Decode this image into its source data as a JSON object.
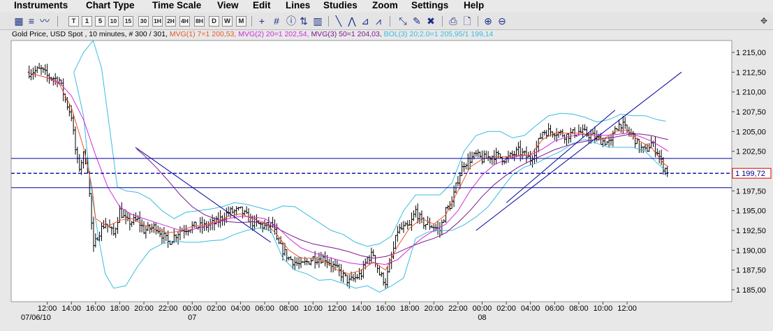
{
  "menu": [
    "Instruments",
    "Chart Type",
    "Time Scale",
    "View",
    "Edit",
    "Lines",
    "Studies",
    "Zoom",
    "Settings",
    "Help"
  ],
  "toolbar": {
    "timescale_buttons": [
      "T",
      "1",
      "5",
      "10",
      "15",
      "30",
      "1H",
      "2H",
      "4H",
      "8H",
      "D",
      "W",
      "M"
    ]
  },
  "legend": {
    "instrument": "Gold Price, USD Spot , 10 minutes, # 300 / 301,",
    "mvg1": "MVG(1) 7=1 200,53,",
    "mvg2": "MVG(2) 20=1 202,54,",
    "mvg3": "MVG(3) 50=1 204,03,",
    "bol": "BOL(3) 20;2.0=1 205,95/1 199,14"
  },
  "colors": {
    "price": "#000000",
    "mvg1": "#e8562a",
    "mvg2": "#d02adc",
    "mvg3": "#7a1a8c",
    "bol": "#38bde0",
    "lines": "#0000a0",
    "last_box": "#e00000"
  },
  "chart_data": {
    "type": "ohlc",
    "ylim": [
      1183.5,
      1216.5
    ],
    "y_ticks": [
      "1 185,00",
      "1 187,50",
      "1 190,00",
      "1 192,50",
      "1 195,00",
      "1 197,50",
      "1 200,00",
      "1 202,50",
      "1 205,00",
      "1 207,50",
      "1 210,00",
      "1 212,50",
      "1 215,00"
    ],
    "y_tick_values": [
      1185,
      1187.5,
      1190,
      1192.5,
      1195,
      1197.5,
      1200,
      1202.5,
      1205,
      1207.5,
      1210,
      1212.5,
      1215
    ],
    "x_ticks": [
      "12:00",
      "14:00",
      "16:00",
      "18:00",
      "20:00",
      "22:00",
      "00:00",
      "02:00",
      "04:00",
      "06:00",
      "08:00",
      "10:00",
      "12:00",
      "14:00",
      "16:00",
      "18:00",
      "20:00",
      "22:00",
      "00:00",
      "02:00",
      "04:00",
      "06:00",
      "08:00",
      "10:00",
      "12:00"
    ],
    "x_dates": [
      "07/06/10",
      "07",
      "08"
    ],
    "last_price_label": "1 199,72",
    "last_price": 1199.72,
    "horizontal_lines": [
      1201.6,
      1199.72,
      1197.9
    ],
    "price_path": [
      [
        10.5,
        1212.5
      ],
      [
        11.5,
        1212.8
      ],
      [
        12,
        1212
      ],
      [
        13,
        1211.5
      ],
      [
        13.5,
        1209
      ],
      [
        14,
        1207
      ],
      [
        14.3,
        1203
      ],
      [
        14.6,
        1200.2
      ],
      [
        15,
        1202
      ],
      [
        15.3,
        1201
      ],
      [
        15.6,
        1195
      ],
      [
        15.8,
        1190
      ],
      [
        16.2,
        1192
      ],
      [
        16.8,
        1193.5
      ],
      [
        17.5,
        1192
      ],
      [
        18,
        1195
      ],
      [
        18.6,
        1193.5
      ],
      [
        19.5,
        1193.8
      ],
      [
        20,
        1192.5
      ],
      [
        21,
        1193
      ],
      [
        22,
        1191
      ],
      [
        23,
        1192.5
      ],
      [
        24,
        1193
      ],
      [
        25,
        1193
      ],
      [
        26,
        1193.5
      ],
      [
        27,
        1194.8
      ],
      [
        28,
        1195
      ],
      [
        29,
        1193.5
      ],
      [
        30,
        1193
      ],
      [
        30.7,
        1193.2
      ],
      [
        31,
        1191
      ],
      [
        32,
        1189
      ],
      [
        33,
        1188
      ],
      [
        34,
        1189
      ],
      [
        35,
        1189
      ],
      [
        36,
        1187.5
      ],
      [
        37,
        1186
      ],
      [
        38,
        1187
      ],
      [
        38.5,
        1189
      ],
      [
        39,
        1189.5
      ],
      [
        39.5,
        1187
      ],
      [
        40,
        1186
      ],
      [
        40.5,
        1189
      ],
      [
        41,
        1192.5
      ],
      [
        42,
        1193
      ],
      [
        42.5,
        1195
      ],
      [
        43,
        1193.5
      ],
      [
        44,
        1193
      ],
      [
        44.5,
        1192.5
      ],
      [
        45,
        1195
      ],
      [
        45.5,
        1196
      ],
      [
        46,
        1199
      ],
      [
        46.5,
        1201
      ],
      [
        47.5,
        1202
      ],
      [
        48,
        1201.5
      ],
      [
        49,
        1202
      ],
      [
        50,
        1201.5
      ],
      [
        51,
        1202.5
      ],
      [
        52,
        1201.5
      ],
      [
        52.5,
        1203
      ],
      [
        53,
        1205
      ],
      [
        54,
        1205
      ],
      [
        55,
        1204.5
      ],
      [
        56,
        1205
      ],
      [
        57,
        1204.5
      ],
      [
        58,
        1203.8
      ],
      [
        58.7,
        1203.5
      ],
      [
        59,
        1205.5
      ],
      [
        59.5,
        1206
      ],
      [
        60,
        1205
      ],
      [
        60.5,
        1204.5
      ],
      [
        61,
        1203
      ],
      [
        61.5,
        1202.5
      ],
      [
        62,
        1203.5
      ],
      [
        62.5,
        1202.5
      ],
      [
        63,
        1200.5
      ],
      [
        63.4,
        1200
      ]
    ],
    "mvg1": [
      [
        10.5,
        1212.4
      ],
      [
        12,
        1211.8
      ],
      [
        13,
        1211
      ],
      [
        14,
        1208
      ],
      [
        15,
        1203
      ],
      [
        15.7,
        1198
      ],
      [
        16,
        1194
      ],
      [
        17,
        1193
      ],
      [
        18,
        1193.8
      ],
      [
        19,
        1194
      ],
      [
        20,
        1193.2
      ],
      [
        21,
        1192.6
      ],
      [
        22,
        1192.2
      ],
      [
        23,
        1192.4
      ],
      [
        24,
        1193
      ],
      [
        25,
        1193.2
      ],
      [
        26,
        1193.6
      ],
      [
        27,
        1194.3
      ],
      [
        28,
        1194.6
      ],
      [
        29,
        1194
      ],
      [
        30,
        1193.5
      ],
      [
        31,
        1192
      ],
      [
        32,
        1190
      ],
      [
        33,
        1189
      ],
      [
        34,
        1189
      ],
      [
        35,
        1188.5
      ],
      [
        36,
        1187.5
      ],
      [
        37,
        1187
      ],
      [
        38,
        1187.5
      ],
      [
        39,
        1188.5
      ],
      [
        40,
        1187.5
      ],
      [
        41,
        1190.5
      ],
      [
        42,
        1192.8
      ],
      [
        43,
        1194
      ],
      [
        44,
        1193.3
      ],
      [
        45,
        1194.5
      ],
      [
        46,
        1197.5
      ],
      [
        47,
        1200.5
      ],
      [
        48,
        1201.5
      ],
      [
        49,
        1201.8
      ],
      [
        50,
        1201.8
      ],
      [
        51,
        1202
      ],
      [
        52,
        1202
      ],
      [
        53,
        1204
      ],
      [
        54,
        1204.8
      ],
      [
        55,
        1204.8
      ],
      [
        56,
        1204.8
      ],
      [
        57,
        1204.6
      ],
      [
        58,
        1204
      ],
      [
        59,
        1205
      ],
      [
        60,
        1205.2
      ],
      [
        61,
        1203.8
      ],
      [
        62,
        1203
      ],
      [
        63,
        1201
      ],
      [
        63.4,
        1200.5
      ]
    ],
    "mvg2": [
      [
        10.5,
        1212.4
      ],
      [
        12,
        1211.8
      ],
      [
        13,
        1211.2
      ],
      [
        14,
        1209.5
      ],
      [
        15,
        1206.5
      ],
      [
        16,
        1202
      ],
      [
        17,
        1198
      ],
      [
        18,
        1195.5
      ],
      [
        19,
        1194.5
      ],
      [
        20,
        1194
      ],
      [
        21,
        1193.5
      ],
      [
        22,
        1193
      ],
      [
        23,
        1192.5
      ],
      [
        24,
        1192.6
      ],
      [
        25,
        1193
      ],
      [
        26,
        1193.5
      ],
      [
        27,
        1194
      ],
      [
        28,
        1194.3
      ],
      [
        29,
        1194.2
      ],
      [
        30,
        1194
      ],
      [
        31,
        1193
      ],
      [
        32,
        1191.5
      ],
      [
        33,
        1190.3
      ],
      [
        34,
        1189.7
      ],
      [
        35,
        1189.2
      ],
      [
        36,
        1188.8
      ],
      [
        37,
        1188.4
      ],
      [
        38,
        1188.2
      ],
      [
        39,
        1188.4
      ],
      [
        40,
        1188.2
      ],
      [
        41,
        1188.8
      ],
      [
        42,
        1190.2
      ],
      [
        43,
        1191.5
      ],
      [
        44,
        1192.5
      ],
      [
        45,
        1193.3
      ],
      [
        46,
        1195
      ],
      [
        47,
        1197.5
      ],
      [
        48,
        1199.5
      ],
      [
        49,
        1200.8
      ],
      [
        50,
        1201.5
      ],
      [
        51,
        1201.9
      ],
      [
        52,
        1202
      ],
      [
        53,
        1202.8
      ],
      [
        54,
        1203.8
      ],
      [
        55,
        1204.3
      ],
      [
        56,
        1204.6
      ],
      [
        57,
        1204.7
      ],
      [
        58,
        1204.5
      ],
      [
        59,
        1204.6
      ],
      [
        60,
        1204.8
      ],
      [
        61,
        1204.4
      ],
      [
        62,
        1203.8
      ],
      [
        63,
        1202.9
      ],
      [
        63.4,
        1202.5
      ]
    ],
    "mvg3": [
      [
        19.4,
        1202.8
      ],
      [
        20,
        1202
      ],
      [
        21,
        1200.5
      ],
      [
        22,
        1198.8
      ],
      [
        23,
        1197
      ],
      [
        24,
        1195.5
      ],
      [
        25,
        1194.5
      ],
      [
        26,
        1193.9
      ],
      [
        27,
        1193.6
      ],
      [
        28,
        1193.5
      ],
      [
        29,
        1193.6
      ],
      [
        30,
        1193.4
      ],
      [
        31,
        1192.8
      ],
      [
        32,
        1192
      ],
      [
        33,
        1191.3
      ],
      [
        34,
        1190.8
      ],
      [
        35,
        1190.5
      ],
      [
        36,
        1190.2
      ],
      [
        37,
        1189.8
      ],
      [
        38,
        1189.3
      ],
      [
        39,
        1189
      ],
      [
        40,
        1189.2
      ],
      [
        41,
        1189.7
      ],
      [
        42,
        1190.4
      ],
      [
        43,
        1191
      ],
      [
        44,
        1191.5
      ],
      [
        45,
        1192.2
      ],
      [
        46,
        1193.5
      ],
      [
        47,
        1195
      ],
      [
        48,
        1196.8
      ],
      [
        49,
        1198.3
      ],
      [
        50,
        1199.5
      ],
      [
        51,
        1200.5
      ],
      [
        52,
        1201.3
      ],
      [
        53,
        1202
      ],
      [
        54,
        1202.7
      ],
      [
        55,
        1203.2
      ],
      [
        56,
        1203.6
      ],
      [
        57,
        1203.9
      ],
      [
        58,
        1204.1
      ],
      [
        59,
        1204.3
      ],
      [
        60,
        1204.6
      ],
      [
        61,
        1204.7
      ],
      [
        62,
        1204.5
      ],
      [
        63,
        1204.1
      ],
      [
        63.4,
        1204
      ]
    ],
    "bol_upper": [
      [
        14.2,
        1212.5
      ],
      [
        15,
        1215
      ],
      [
        15.8,
        1216.5
      ],
      [
        16.5,
        1213
      ],
      [
        17.2,
        1205
      ],
      [
        17.8,
        1198
      ],
      [
        18.5,
        1197.5
      ],
      [
        19.5,
        1197.3
      ],
      [
        20.5,
        1196.5
      ],
      [
        21.5,
        1195
      ],
      [
        22.5,
        1194
      ],
      [
        23.5,
        1194.8
      ],
      [
        24.5,
        1195
      ],
      [
        25.5,
        1195.2
      ],
      [
        26.5,
        1195.5
      ],
      [
        27.5,
        1196
      ],
      [
        28.5,
        1195.8
      ],
      [
        29.5,
        1195.4
      ],
      [
        30.5,
        1195
      ],
      [
        31.5,
        1195.6
      ],
      [
        32.5,
        1195.5
      ],
      [
        33.5,
        1194.5
      ],
      [
        34.5,
        1193.5
      ],
      [
        35.5,
        1192.5
      ],
      [
        36.5,
        1192
      ],
      [
        37.5,
        1191
      ],
      [
        38.5,
        1190.5
      ],
      [
        39.5,
        1190.8
      ],
      [
        40.5,
        1191.8
      ],
      [
        41.5,
        1195
      ],
      [
        42.5,
        1197
      ],
      [
        43.5,
        1197
      ],
      [
        44.5,
        1197
      ],
      [
        45.5,
        1198.5
      ],
      [
        46.5,
        1202.5
      ],
      [
        47.5,
        1204.5
      ],
      [
        48.5,
        1205
      ],
      [
        49.5,
        1205
      ],
      [
        50.5,
        1204.2
      ],
      [
        51.5,
        1204.5
      ],
      [
        52.5,
        1205.8
      ],
      [
        53.5,
        1207
      ],
      [
        54.5,
        1207.3
      ],
      [
        55.5,
        1207.2
      ],
      [
        56.5,
        1206.8
      ],
      [
        57.5,
        1206.2
      ],
      [
        58.5,
        1206.5
      ],
      [
        59.5,
        1207.2
      ],
      [
        60.5,
        1207
      ],
      [
        61.5,
        1207
      ],
      [
        62.5,
        1206.5
      ],
      [
        63.2,
        1206.3
      ]
    ],
    "bol_lower": [
      [
        14.2,
        1212.5
      ],
      [
        15,
        1207
      ],
      [
        15.6,
        1198
      ],
      [
        16.2,
        1192
      ],
      [
        16.8,
        1187
      ],
      [
        17.5,
        1185.2
      ],
      [
        18.5,
        1185.5
      ],
      [
        19.5,
        1188
      ],
      [
        20.5,
        1190
      ],
      [
        21.5,
        1190.8
      ],
      [
        22.5,
        1191.2
      ],
      [
        23.5,
        1191
      ],
      [
        24.5,
        1191
      ],
      [
        25.5,
        1191.2
      ],
      [
        26.5,
        1191.3
      ],
      [
        27.5,
        1192
      ],
      [
        28.5,
        1192.5
      ],
      [
        29.5,
        1192.8
      ],
      [
        30.5,
        1192.5
      ],
      [
        31.5,
        1189
      ],
      [
        32.5,
        1187.5
      ],
      [
        33.5,
        1187
      ],
      [
        34.5,
        1186.2
      ],
      [
        35.5,
        1186.3
      ],
      [
        36.5,
        1185.8
      ],
      [
        37.5,
        1185.2
      ],
      [
        38.5,
        1185.5
      ],
      [
        39.5,
        1184.7
      ],
      [
        40.5,
        1185.5
      ],
      [
        41.5,
        1186.5
      ],
      [
        42.5,
        1191.5
      ],
      [
        43.5,
        1192.3
      ],
      [
        44.5,
        1192.5
      ],
      [
        45.5,
        1192.5
      ],
      [
        46.5,
        1193.2
      ],
      [
        47.5,
        1194.2
      ],
      [
        48.5,
        1195.5
      ],
      [
        49.5,
        1197.5
      ],
      [
        50.5,
        1199.5
      ],
      [
        51.5,
        1200.5
      ],
      [
        52.5,
        1201
      ],
      [
        53.5,
        1201.8
      ],
      [
        54.5,
        1202.5
      ],
      [
        55.5,
        1203.5
      ],
      [
        56.5,
        1204
      ],
      [
        57.5,
        1203.5
      ],
      [
        58.5,
        1203
      ],
      [
        59.5,
        1203
      ],
      [
        60.5,
        1203
      ],
      [
        61.5,
        1202.5
      ],
      [
        62.5,
        1201
      ],
      [
        63.2,
        1200
      ]
    ],
    "trend_lines": [
      [
        [
          19.3,
          1203
        ],
        [
          30.5,
          1191
        ]
      ],
      [
        [
          47.5,
          1192.5
        ],
        [
          64.5,
          1212.5
        ]
      ],
      [
        [
          50,
          1196
        ],
        [
          59,
          1207.7
        ]
      ]
    ]
  }
}
